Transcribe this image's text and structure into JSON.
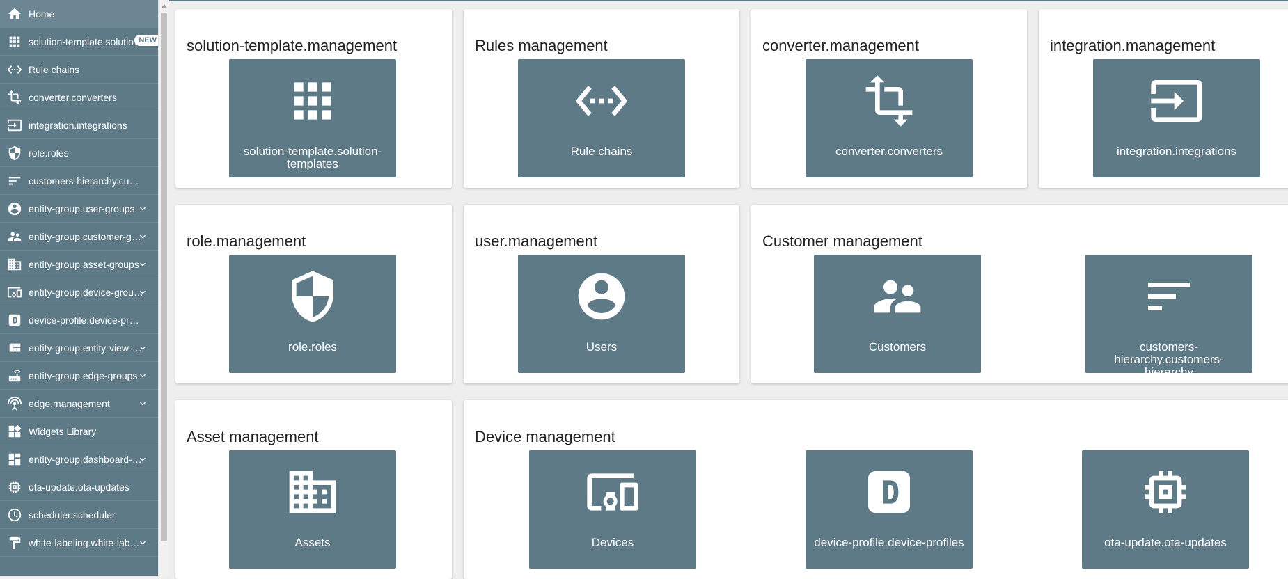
{
  "sidebar": {
    "items": [
      {
        "label": "Home",
        "icon": "home-icon"
      },
      {
        "label": "solution-template.solution-templates",
        "icon": "apps-icon",
        "badge": "NEW"
      },
      {
        "label": "Rule chains",
        "icon": "settings-ethernet-icon"
      },
      {
        "label": "converter.converters",
        "icon": "transform-icon"
      },
      {
        "label": "integration.integrations",
        "icon": "input-icon"
      },
      {
        "label": "role.roles",
        "icon": "security-icon"
      },
      {
        "label": "customers-hierarchy.customers-hierarchy",
        "icon": "sort-icon"
      },
      {
        "label": "entity-group.user-groups",
        "icon": "account-circle-icon",
        "expandable": true
      },
      {
        "label": "entity-group.customer-groups",
        "icon": "supervisor-account-icon",
        "expandable": true
      },
      {
        "label": "entity-group.asset-groups",
        "icon": "domain-icon",
        "expandable": true
      },
      {
        "label": "entity-group.device-groups",
        "icon": "devices-other-icon",
        "expandable": true
      },
      {
        "label": "device-profile.device-profiles",
        "icon": "device-profile-icon"
      },
      {
        "label": "entity-group.entity-view-groups",
        "icon": "view-quilt-icon",
        "expandable": true
      },
      {
        "label": "entity-group.edge-groups",
        "icon": "router-icon",
        "expandable": true
      },
      {
        "label": "edge.management",
        "icon": "settings-input-antenna-icon",
        "expandable": true
      },
      {
        "label": "Widgets Library",
        "icon": "widgets-icon"
      },
      {
        "label": "entity-group.dashboard-groups",
        "icon": "dashboard-icon",
        "expandable": true
      },
      {
        "label": "ota-update.ota-updates",
        "icon": "memory-icon"
      },
      {
        "label": "scheduler.scheduler",
        "icon": "schedule-icon"
      },
      {
        "label": "white-labeling.white-labeling",
        "icon": "format-paint-icon",
        "expandable": true
      }
    ]
  },
  "cards": [
    {
      "title": "solution-template.management",
      "tiles": [
        {
          "label": "solution-template.solution-templates",
          "icon": "apps-icon"
        }
      ]
    },
    {
      "title": "Rules management",
      "tiles": [
        {
          "label": "Rule chains",
          "icon": "settings-ethernet-icon"
        }
      ]
    },
    {
      "title": "converter.management",
      "tiles": [
        {
          "label": "converter.converters",
          "icon": "transform-icon"
        }
      ]
    },
    {
      "title": "integration.management",
      "tiles": [
        {
          "label": "integration.integrations",
          "icon": "input-icon"
        }
      ]
    },
    {
      "title": "role.management",
      "tiles": [
        {
          "label": "role.roles",
          "icon": "security-icon"
        }
      ]
    },
    {
      "title": "user.management",
      "tiles": [
        {
          "label": "Users",
          "icon": "account-circle-icon"
        }
      ]
    },
    {
      "title": "Customer management",
      "tiles": [
        {
          "label": "Customers",
          "icon": "supervisor-account-icon"
        },
        {
          "label": "customers-hierarchy.customers-hierarchy",
          "icon": "sort-icon"
        }
      ]
    },
    {
      "title": "Asset management",
      "tiles": [
        {
          "label": "Assets",
          "icon": "domain-icon"
        }
      ]
    },
    {
      "title": "Device management",
      "tiles": [
        {
          "label": "Devices",
          "icon": "devices-other-icon"
        },
        {
          "label": "device-profile.device-profiles",
          "icon": "device-profile-icon"
        },
        {
          "label": "ota-update.ota-updates",
          "icon": "memory-icon"
        }
      ]
    }
  ]
}
